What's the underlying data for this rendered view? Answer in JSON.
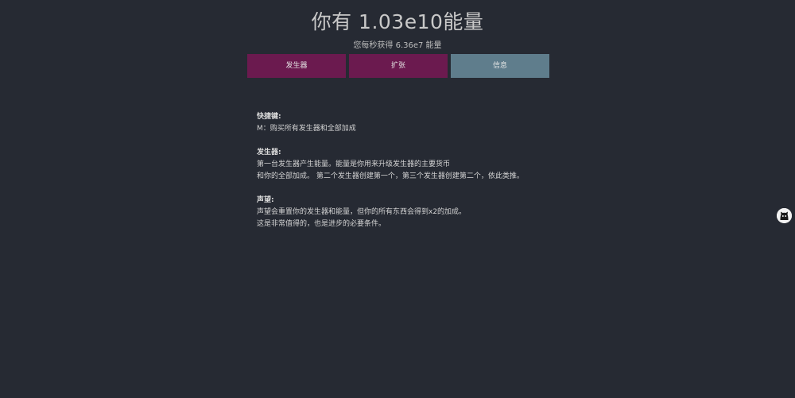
{
  "header": {
    "energy_title": "你有 1.03e10能量",
    "rate_line": "您每秒获得 6.36e7 能量"
  },
  "tabs": [
    {
      "label": "发生器",
      "active": false
    },
    {
      "label": "扩张",
      "active": false
    },
    {
      "label": "信息",
      "active": true
    }
  ],
  "info": {
    "shortcuts": {
      "title": "快捷键:",
      "lines": [
        "M：购买所有发生器和全部加成"
      ]
    },
    "generators": {
      "title": "发生器:",
      "lines": [
        "第一台发生器产生能量。能量是你用来升级发生器的主要货币",
        "和你的全部加成。 第二个发生器创建第一个，第三个发生器创建第二个，依此类推。"
      ]
    },
    "prestige": {
      "title": "声望:",
      "lines": [
        "声望会重置你的发生器和能量，但你的所有东西会得到x2的加成。",
        "这是非常值得的，也是进步的必要条件。"
      ]
    }
  },
  "colors": {
    "background": "#262a33",
    "tab_inactive": "#6b1a4f",
    "tab_active": "#5f7d8c"
  },
  "side_icon": {
    "name": "github-icon"
  }
}
